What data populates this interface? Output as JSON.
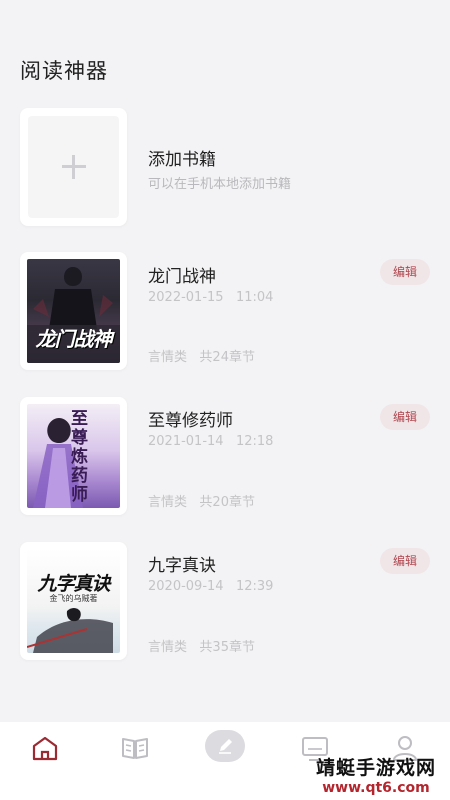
{
  "app": {
    "title": "阅读神器"
  },
  "add_book": {
    "title": "添加书籍",
    "subtitle": "可以在手机本地添加书籍"
  },
  "books": [
    {
      "title": "龙门战神",
      "date": "2022-01-15",
      "time": "11:04",
      "category": "言情类",
      "chapters": "共24章节",
      "edit_label": "编辑",
      "cover_text": "龙门战神"
    },
    {
      "title": "至尊修药师",
      "date": "2021-01-14",
      "time": "12:18",
      "category": "言情类",
      "chapters": "共20章节",
      "edit_label": "编辑",
      "cover_text": "至尊炼药师"
    },
    {
      "title": "九字真诀",
      "date": "2020-09-14",
      "time": "12:39",
      "category": "言情类",
      "chapters": "共35章节",
      "edit_label": "编辑",
      "cover_text": "九字真诀",
      "cover_author": "金飞的乌贼著"
    }
  ],
  "bottom_nav": {
    "items": [
      {
        "icon": "home-icon",
        "active": true
      },
      {
        "icon": "book-open-icon",
        "active": false
      },
      {
        "icon": "pen-icon",
        "active": false
      },
      {
        "icon": "monitor-icon",
        "active": false
      },
      {
        "icon": "user-icon",
        "active": false
      }
    ],
    "active_color": "#9b2a32",
    "inactive_color": "#bdbdc2"
  },
  "watermark": {
    "line1": "靖蜓手游戏网",
    "line2": "www.qt6.com"
  },
  "colors": {
    "edit_bg": "#f0e6e7",
    "edit_text": "#b14850",
    "background": "#f3f3f5"
  }
}
